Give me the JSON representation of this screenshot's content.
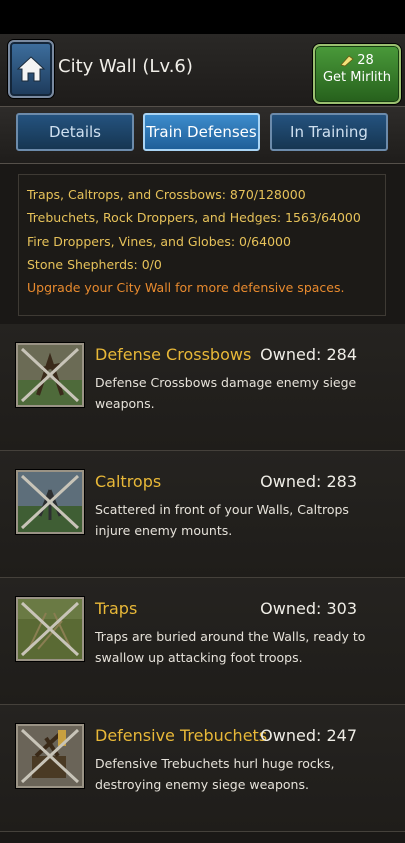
{
  "header": {
    "title": "City Wall (Lv.6)",
    "mirlith_count": "28",
    "mirlith_label": "Get Mirlith"
  },
  "tabs": [
    {
      "label": "Details",
      "active": false
    },
    {
      "label": "Train Defenses",
      "active": true
    },
    {
      "label": "In Training",
      "active": false
    }
  ],
  "capacity": {
    "lines": [
      "Traps, Caltrops, and Crossbows: 870/128000",
      "Trebuchets, Rock Droppers, and Hedges: 1563/64000",
      "Fire Droppers, Vines, and Globes: 0/64000",
      "Stone Shepherds: 0/0"
    ],
    "upgrade_note": "Upgrade your City Wall for more defensive spaces."
  },
  "defenses": [
    {
      "name": "Defense Crossbows",
      "owned": "Owned: 284",
      "description": "Defense Crossbows damage enemy siege weapons.",
      "icon": "crossbow-icon"
    },
    {
      "name": "Caltrops",
      "owned": "Owned: 283",
      "description": "Scattered in front of your Walls, Caltrops injure enemy mounts.",
      "icon": "caltrops-icon"
    },
    {
      "name": "Traps",
      "owned": "Owned: 303",
      "description": "Traps are buried around the Walls, ready to swallow up attacking foot troops.",
      "icon": "traps-icon"
    },
    {
      "name": "Defensive Trebuchets",
      "owned": "Owned: 247",
      "description": "Defensive Trebuchets hurl huge rocks, destroying enemy siege weapons.",
      "icon": "trebuchet-icon"
    }
  ],
  "colors": {
    "accent_gold": "#e8b838",
    "warn_orange": "#e88a2e",
    "tab_active": "#3d8ccc",
    "mirlith_green": "#4a9a3a"
  }
}
